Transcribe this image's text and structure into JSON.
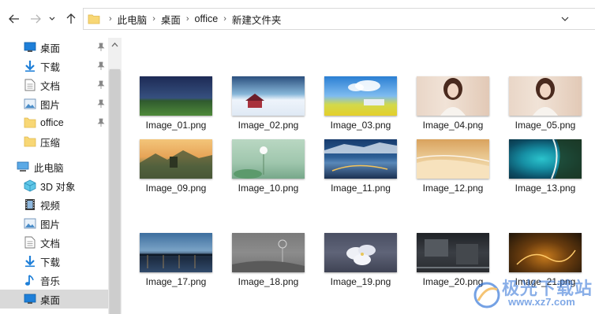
{
  "address": {
    "crumbs": [
      "此电脑",
      "桌面",
      "office",
      "新建文件夹"
    ]
  },
  "sidebar": {
    "quick_access": [
      {
        "label": "桌面",
        "icon": "desktop-icon",
        "pinned": true
      },
      {
        "label": "下载",
        "icon": "download-icon",
        "pinned": true
      },
      {
        "label": "文档",
        "icon": "document-icon",
        "pinned": true
      },
      {
        "label": "图片",
        "icon": "pictures-icon",
        "pinned": true
      },
      {
        "label": "office",
        "icon": "folder-icon",
        "pinned": true
      },
      {
        "label": "压缩",
        "icon": "folder-icon",
        "pinned": false
      }
    ],
    "this_pc_label": "此电脑",
    "this_pc_items": [
      {
        "label": "3D 对象",
        "icon": "3d-objects-icon"
      },
      {
        "label": "视频",
        "icon": "video-icon"
      },
      {
        "label": "图片",
        "icon": "pictures-icon"
      },
      {
        "label": "文档",
        "icon": "document-icon"
      },
      {
        "label": "下载",
        "icon": "download-icon"
      },
      {
        "label": "音乐",
        "icon": "music-icon"
      },
      {
        "label": "桌面",
        "icon": "desktop-icon",
        "selected": true
      }
    ]
  },
  "files": [
    {
      "name": "Image_01.png"
    },
    {
      "name": "Image_02.png"
    },
    {
      "name": "Image_03.png"
    },
    {
      "name": "Image_04.png"
    },
    {
      "name": "Image_05.png"
    },
    {
      "name": "Image_09.png"
    },
    {
      "name": "Image_10.png"
    },
    {
      "name": "Image_11.png"
    },
    {
      "name": "Image_12.png"
    },
    {
      "name": "Image_13.png"
    },
    {
      "name": "Image_17.png"
    },
    {
      "name": "Image_18.png"
    },
    {
      "name": "Image_19.png"
    },
    {
      "name": "Image_20.png"
    },
    {
      "name": "Image_21.png"
    }
  ],
  "watermark": {
    "line1": "极光下载站",
    "line2": "www.xz7.com"
  },
  "colors": {
    "selection": "#d9d9d9",
    "folder": "#f8d775",
    "accent": "#1e7fd8"
  }
}
